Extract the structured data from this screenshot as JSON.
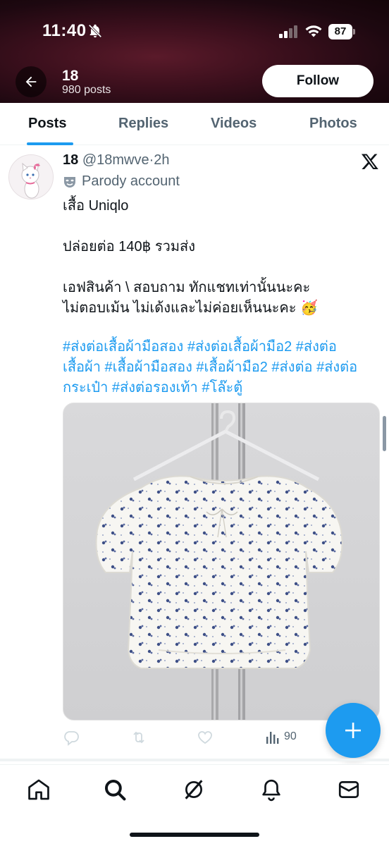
{
  "status_bar": {
    "time": "11:40",
    "battery": "87"
  },
  "header": {
    "name": "18",
    "post_count": "980 posts",
    "follow_label": "Follow"
  },
  "tabs": [
    {
      "label": "Posts",
      "active": true
    },
    {
      "label": "Replies",
      "active": false
    },
    {
      "label": "Videos",
      "active": false
    },
    {
      "label": "Photos",
      "active": false
    }
  ],
  "post": {
    "display_name": "18",
    "handle": "@18mwve",
    "separator": "·",
    "time_ago": "2h",
    "label": "Parody account",
    "text_lines": [
      "เสื้อ Uniqlo",
      "",
      "ปล่อยต่อ 140฿ รวมส่ง",
      "",
      "เอฟสินค้า \\ สอบถาม ทักแชทเท่านั้นนะคะ",
      "ไม่ตอบเม้น ไม่เด้งและไม่ค่อยเห็นนะคะ 🥳"
    ],
    "hashtags": "#ส่งต่อเสื้อผ้ามือสอง #ส่งต่อเสื้อผ้ามือ2 #ส่งต่อเสื้อผ้า #เสื้อผ้ามือสอง #เสื้อผ้ามือ2 #ส่งต่อ #ส่งต่อกระเป๋า #ส่งต่อรองเท้า #โล๊ะตู้",
    "views": "90"
  },
  "icons": {
    "back": "arrow-left-icon",
    "bell_off": "bell-off-icon",
    "signal": "cellular-signal-icon",
    "wifi": "wifi-icon",
    "battery": "battery-icon",
    "x_logo": "x-logo-icon",
    "parody": "parody-mask-icon",
    "reply": "reply-icon",
    "repost": "repost-icon",
    "like": "heart-icon",
    "views": "views-chart-icon",
    "compose": "plus-icon",
    "nav": [
      "home-icon",
      "search-icon",
      "grok-icon",
      "notifications-icon",
      "messages-icon"
    ]
  },
  "colors": {
    "accent": "#1d9bf0",
    "text": "#0f1419",
    "muted": "#536471"
  }
}
